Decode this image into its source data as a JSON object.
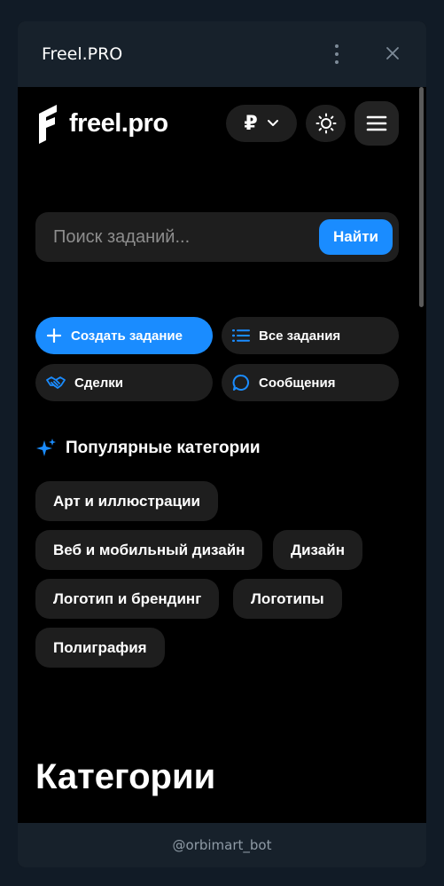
{
  "window": {
    "title": "Freel.PRO"
  },
  "header": {
    "logo_text": "freel.pro",
    "currency_symbol": "₽"
  },
  "search": {
    "placeholder": "Поиск заданий...",
    "button_label": "Найти"
  },
  "actions": [
    {
      "label": "Создать задание",
      "icon": "plus-icon"
    },
    {
      "label": "Все задания",
      "icon": "list-icon"
    },
    {
      "label": "Сделки",
      "icon": "handshake-icon"
    },
    {
      "label": "Сообщения",
      "icon": "chat-bubble-icon"
    }
  ],
  "popular": {
    "heading": "Популярные категории",
    "items": [
      "Арт и иллюстрации",
      "Веб и мобильный дизайн",
      "Дизайн",
      "Логотип и брендинг",
      "Логотипы",
      "Полиграфия"
    ]
  },
  "categories": {
    "heading": "Категории"
  },
  "footer": {
    "bot": "@orbimart_bot"
  },
  "colors": {
    "accent": "#1a8cff",
    "background": "#000000",
    "surface": "#1e1e1e",
    "chrome": "#17212b"
  }
}
